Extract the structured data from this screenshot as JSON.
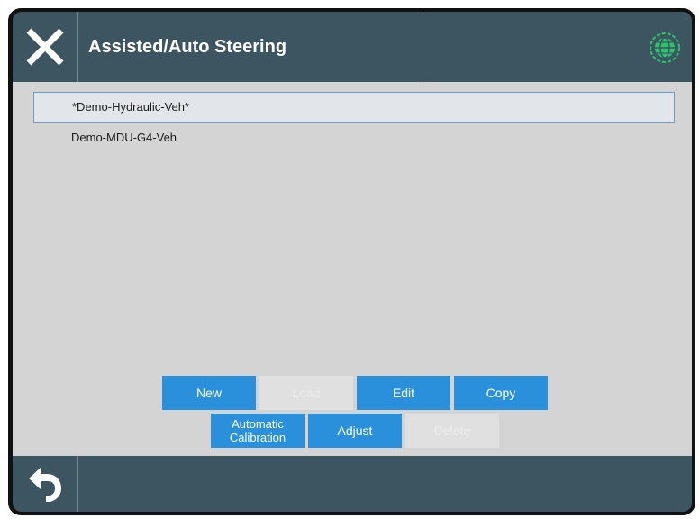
{
  "header": {
    "title": "Assisted/Auto Steering",
    "close_icon": "close-x-icon",
    "status_icon": "globe-status-icon",
    "status_color": "#2cc36b"
  },
  "vehicles": [
    {
      "name": "*Demo-Hydraulic-Veh*",
      "selected": true
    },
    {
      "name": "Demo-MDU-G4-Veh",
      "selected": false
    }
  ],
  "actions": {
    "new": {
      "label": "New",
      "enabled": true
    },
    "load": {
      "label": "Load",
      "enabled": false
    },
    "edit": {
      "label": "Edit",
      "enabled": true
    },
    "copy": {
      "label": "Copy",
      "enabled": true
    },
    "auto_cal": {
      "label_line1": "Automatic",
      "label_line2": "Calibration",
      "enabled": true
    },
    "adjust": {
      "label": "Adjust",
      "enabled": true
    },
    "delete": {
      "label": "Delete",
      "enabled": false
    }
  },
  "footer": {
    "back_icon": "back-arrow-icon"
  },
  "colors": {
    "accent": "#2b90dc",
    "bar": "#3d5561",
    "panel": "#d4d4d4"
  }
}
